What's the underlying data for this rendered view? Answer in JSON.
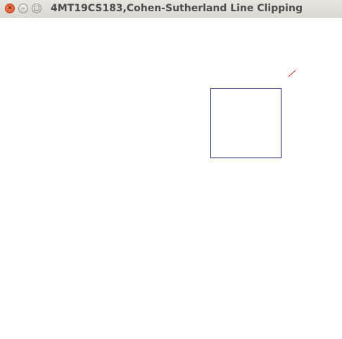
{
  "window": {
    "title": "4MT19CS183,Cohen-Sutherland Line Clipping",
    "controls": {
      "close_icon": "close-icon",
      "minimize_icon": "minimize-icon",
      "maximize_icon": "maximize-icon"
    }
  },
  "canvas": {
    "background": "#ffffff",
    "clip_window_color": "#1a1a66",
    "line_color": "#cc2222"
  }
}
